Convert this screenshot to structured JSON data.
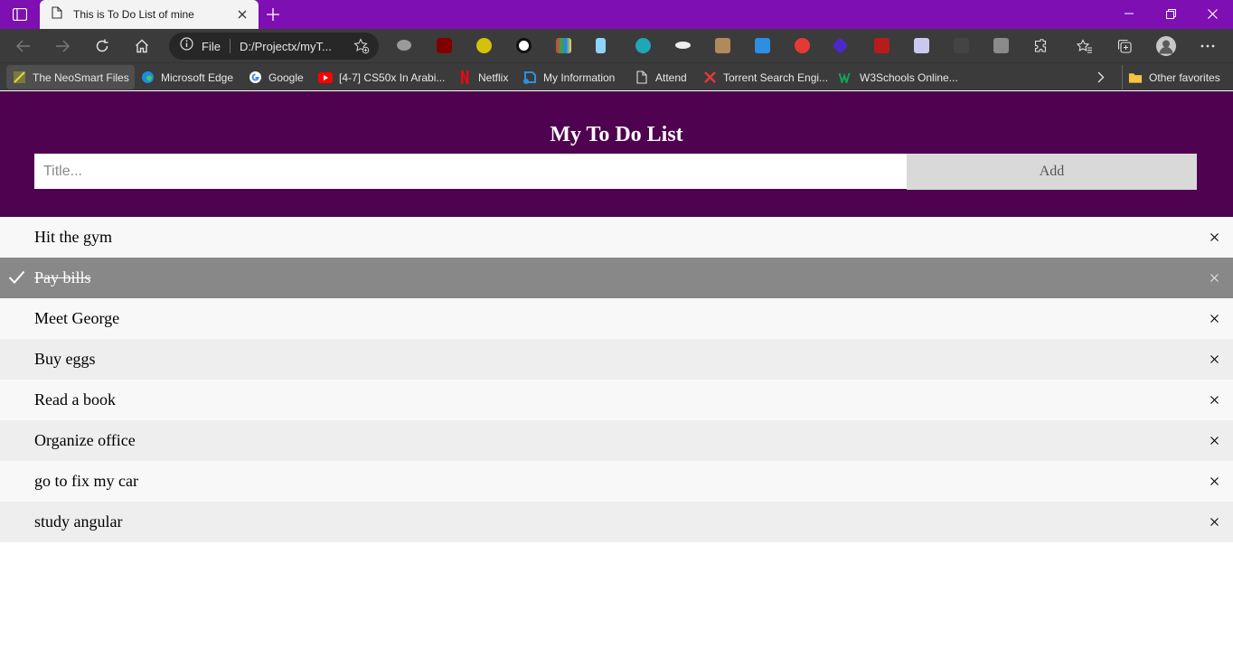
{
  "browser": {
    "tab_title": "This is To Do List of mine",
    "omnibox": {
      "scheme_label": "File",
      "url": "D:/Projectx/myT..."
    },
    "bookmarks": [
      {
        "label": "The NeoSmart Files",
        "icon": "neosmart-icon"
      },
      {
        "label": "Microsoft Edge",
        "icon": "edge-icon"
      },
      {
        "label": "Google",
        "icon": "google-icon"
      },
      {
        "label": "[4-7] CS50x In Arabi...",
        "icon": "youtube-icon"
      },
      {
        "label": "Netflix",
        "icon": "netflix-icon"
      },
      {
        "label": "My Information",
        "icon": "azure-icon"
      },
      {
        "label": "Attend",
        "icon": "page-icon"
      },
      {
        "label": "Torrent Search Engi...",
        "icon": "torrent-icon"
      },
      {
        "label": "W3Schools Online...",
        "icon": "w3schools-icon"
      }
    ],
    "other_favorites": "Other favorites",
    "colors": {
      "titlebar": "#7d0fb3",
      "toolbar": "#3b3b3b"
    }
  },
  "app": {
    "heading": "My To Do List",
    "input_placeholder": "Title...",
    "add_label": "Add",
    "header_color": "#4e0250",
    "close_symbol": "×",
    "items": [
      {
        "text": "Hit the gym",
        "checked": false
      },
      {
        "text": "Pay bills",
        "checked": true
      },
      {
        "text": "Meet George",
        "checked": false
      },
      {
        "text": "Buy eggs",
        "checked": false
      },
      {
        "text": "Read a book",
        "checked": false
      },
      {
        "text": "Organize office",
        "checked": false
      },
      {
        "text": "go to fix my car",
        "checked": false
      },
      {
        "text": "study angular",
        "checked": false
      }
    ]
  }
}
